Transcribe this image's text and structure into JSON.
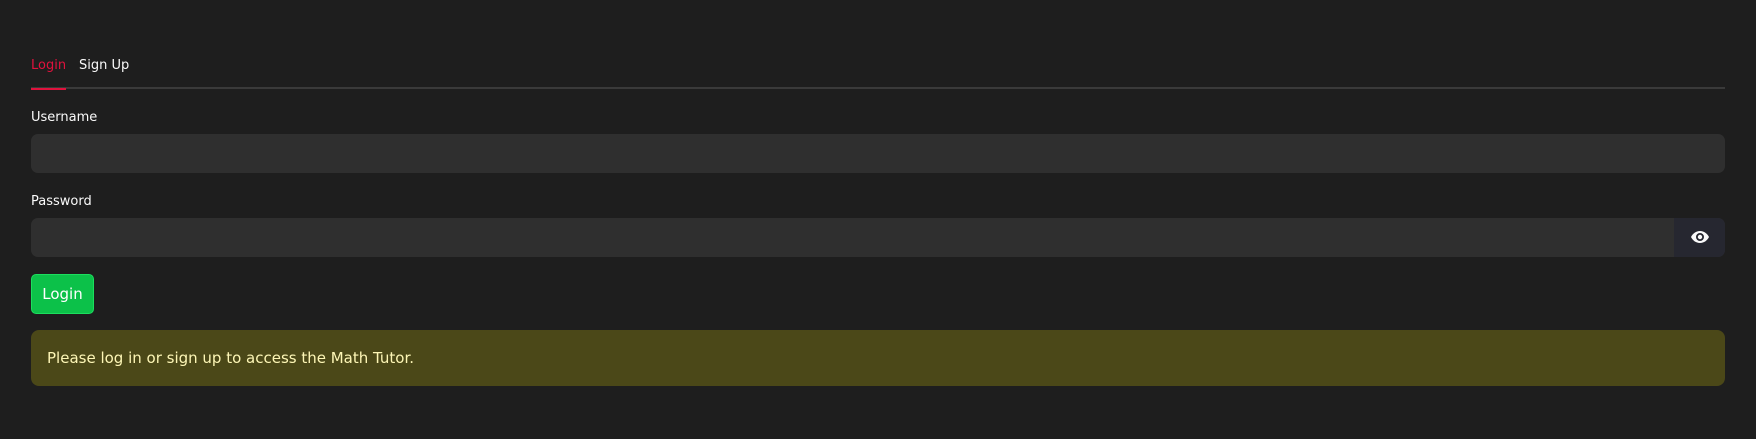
{
  "tabs": [
    {
      "label": "Login",
      "active": true
    },
    {
      "label": "Sign Up",
      "active": false
    }
  ],
  "form": {
    "username_label": "Username",
    "username_value": "",
    "password_label": "Password",
    "password_value": "",
    "password_toggle_icon": "eye-icon",
    "login_button_label": "Login"
  },
  "alert": {
    "message": "Please log in or sign up to access the Math Tutor."
  },
  "colors": {
    "background": "#1e1e1e",
    "input_background": "#2f2f2f",
    "tab_active": "#e0123d",
    "button_primary": "#0cc149",
    "alert_background": "#4b4818",
    "alert_text": "#fdf6b6"
  }
}
